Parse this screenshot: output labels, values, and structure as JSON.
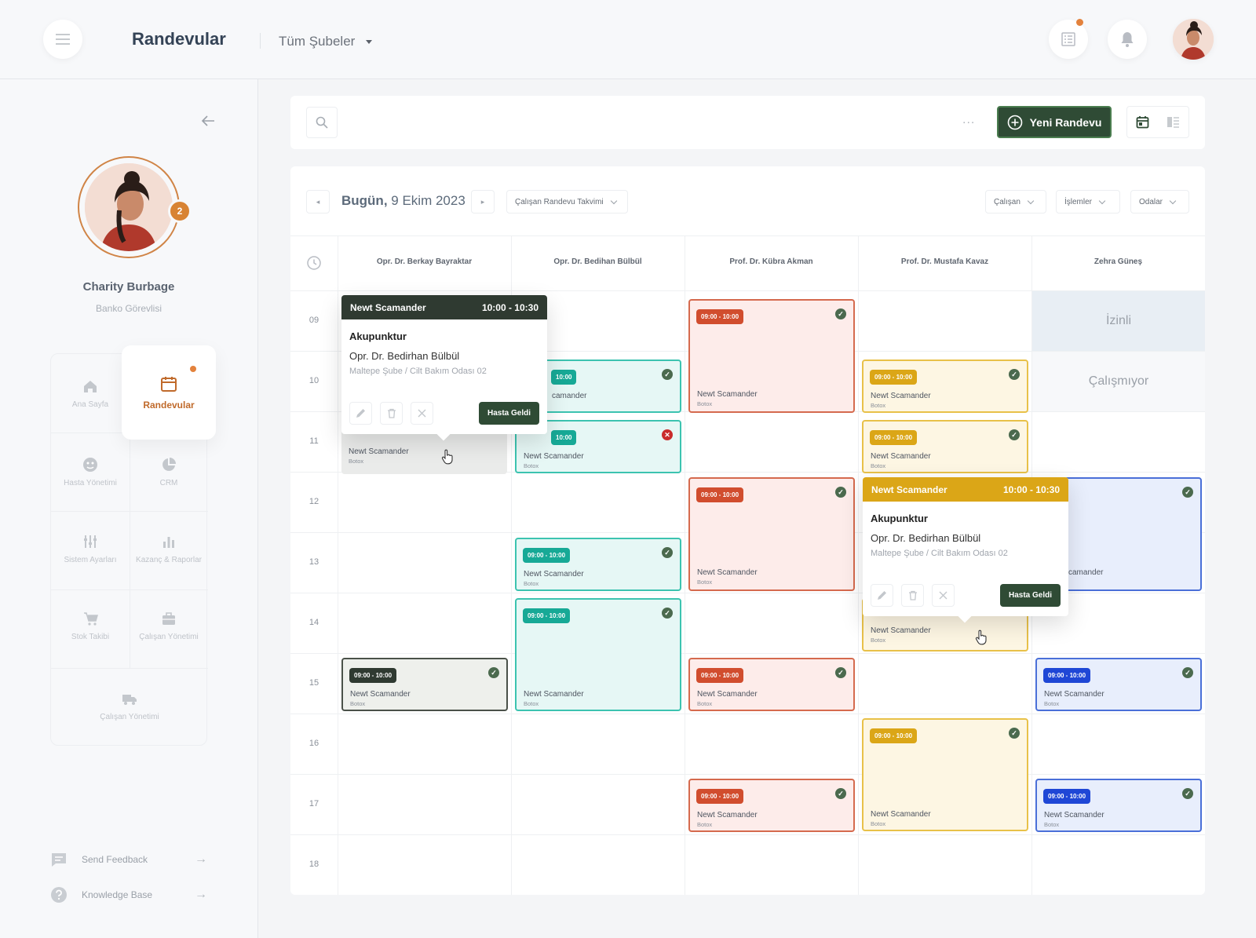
{
  "header": {
    "title": "Randevular",
    "branch": "Tüm Şubeler"
  },
  "user": {
    "name": "Charity Burbage",
    "role": "Banko Görevlisi",
    "notifications": "2"
  },
  "menu": {
    "home": "Ana Sayfa",
    "appointments": "Randevular",
    "patients": "Hasta Yönetimi",
    "crm": "CRM",
    "settings": "Sistem Ayarları",
    "reports": "Kazanç & Raporlar",
    "stock": "Stok Takibi",
    "staff": "Çalışan Yönetimi",
    "staff2": "Çalışan Yönetimi"
  },
  "footer": {
    "feedback": "Send Feedback",
    "kb": "Knowledge Base"
  },
  "toolbar": {
    "new_button": "Yeni Randevu",
    "more": "..."
  },
  "calendar": {
    "today_label": "Bugün,",
    "date": "9 Ekim 2023",
    "view_select": "Çalışan Randevu Takvimi",
    "filters": [
      "Çalışan",
      "İşlemler",
      "Odalar"
    ],
    "columns": [
      "Opr. Dr. Berkay Bayraktar",
      "Opr. Dr. Bedihan Bülbül",
      "Prof. Dr. Kübra Akman",
      "Prof. Dr. Mustafa Kavaz",
      "Zehra Güneş"
    ],
    "hours": [
      "09",
      "10",
      "11",
      "12",
      "13",
      "14",
      "15",
      "16",
      "17",
      "18"
    ],
    "izinli": "İzinli",
    "calismiyor": "Çalışmıyor",
    "appt_time": "09:00 - 10:00",
    "appt_name": "Newt Scamander",
    "appt_service": "Botox",
    "partial_time": "10:00",
    "partial_name": "camander"
  },
  "popup": {
    "name": "Newt Scamander",
    "time": "10:00 - 10:30",
    "procedure": "Akupunktur",
    "doctor": "Opr. Dr. Bedirhan Bülbül",
    "location": "Maltepe Şube / Cilt Bakım Odası 02",
    "action": "Hasta Geldi"
  },
  "colors": {
    "brand": "#2f4b35",
    "accent": "#c06a2b",
    "red": "#d14d2e",
    "teal": "#17a996",
    "yellow": "#dba617",
    "blue": "#1f47d6"
  }
}
